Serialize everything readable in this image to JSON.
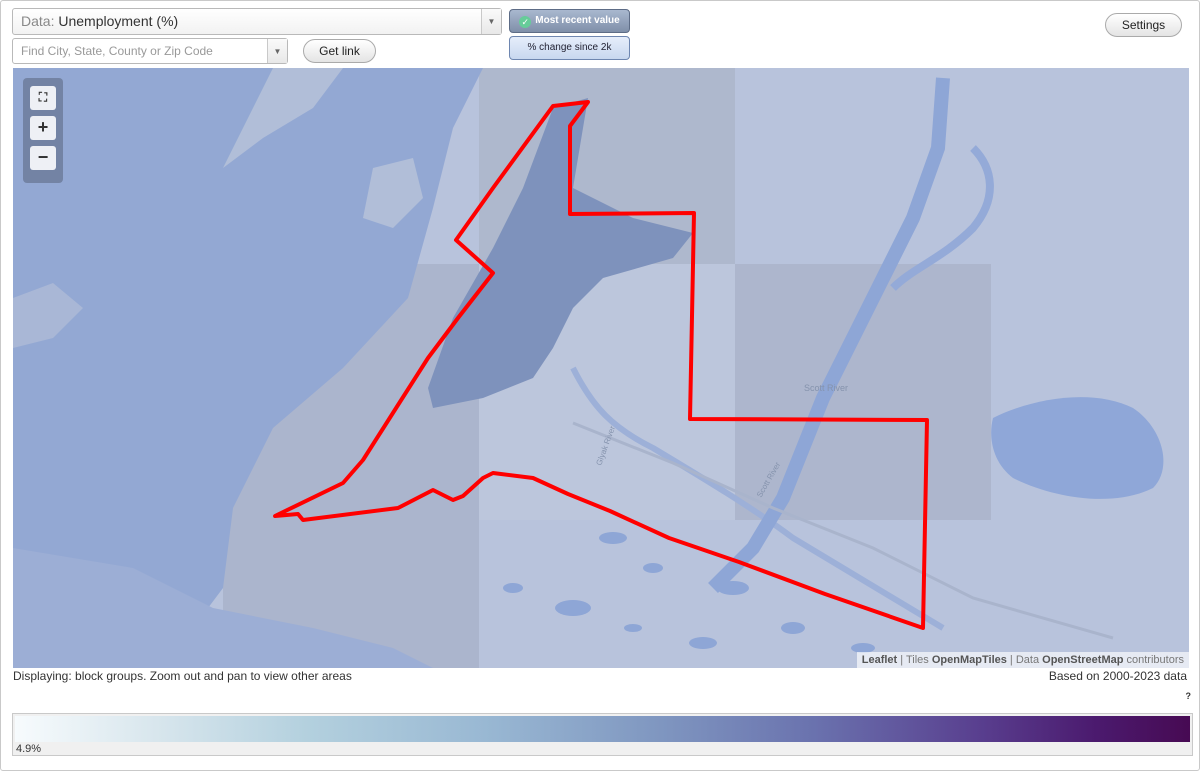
{
  "controls": {
    "data_label": "Data:",
    "data_value": "Unemployment (%)",
    "search_placeholder": "Find City, State, County or Zip Code",
    "get_link": "Get link",
    "most_recent": "Most recent value",
    "percent_change": "% change since 2k",
    "settings": "Settings"
  },
  "map": {
    "place_labels": [
      "Scott River",
      "Glyak River",
      "Scott River"
    ],
    "attribution": {
      "leaflet": "Leaflet",
      "tiles_prefix": "Tiles",
      "tiles": "OpenMapTiles",
      "data_prefix": "Data",
      "data": "OpenStreetMap",
      "suffix": "contributors"
    },
    "boundary_color": "#ff0000",
    "water_color": "#96add8",
    "land_color": "#b8c3dc"
  },
  "footer": {
    "displaying": "Displaying: block groups. Zoom out and pan to view other areas",
    "based_on": "Based on 2000-2023 data",
    "help": "?"
  },
  "legend": {
    "min_label": "4.9%"
  }
}
